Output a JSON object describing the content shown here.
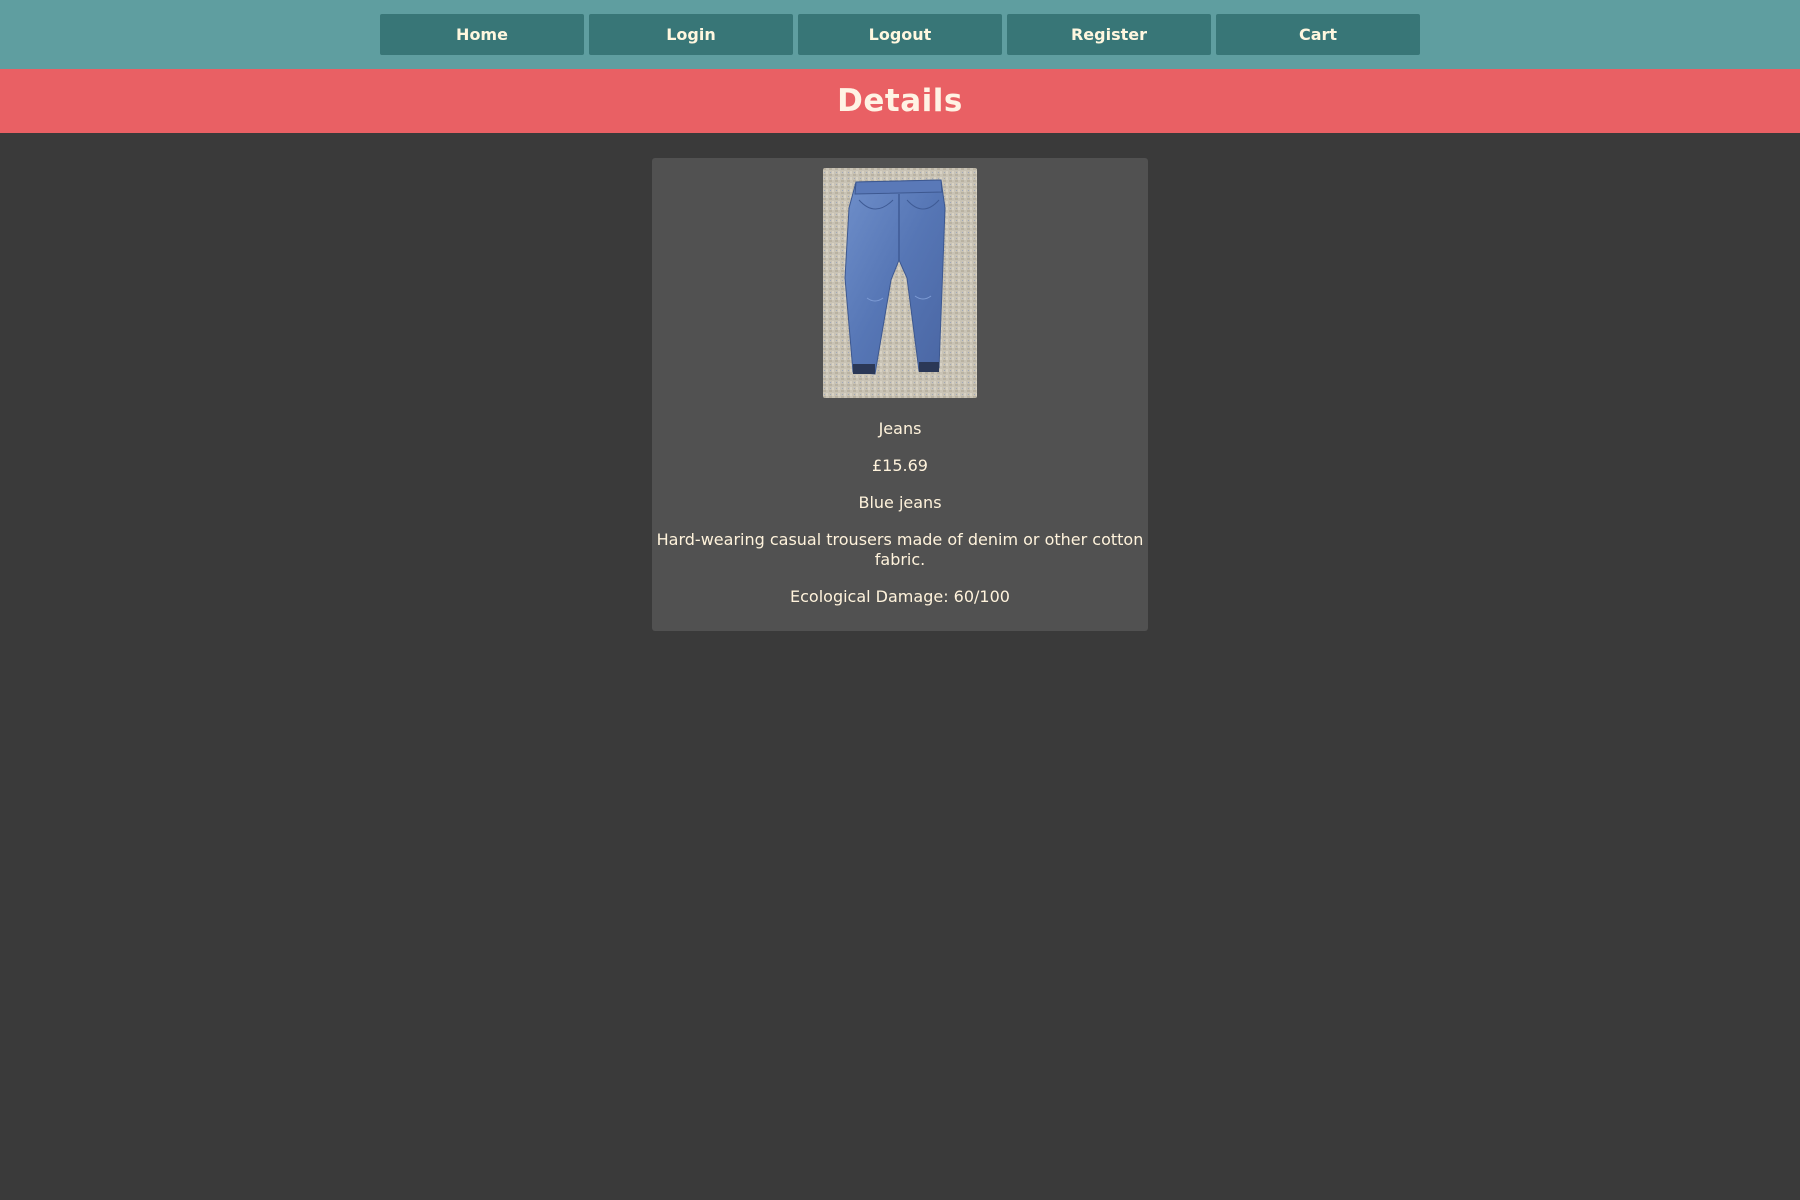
{
  "nav": {
    "items": [
      {
        "label": "Home"
      },
      {
        "label": "Login"
      },
      {
        "label": "Logout"
      },
      {
        "label": "Register"
      },
      {
        "label": "Cart"
      }
    ]
  },
  "header": {
    "title": "Details"
  },
  "product": {
    "image_icon": "jeans-photo",
    "name": "Jeans",
    "price": "£15.69",
    "short_description": "Blue jeans",
    "long_description": "Hard-wearing casual trousers made of denim or other cotton fabric.",
    "ecological_damage": "Ecological Damage: 60/100"
  },
  "colors": {
    "nav_background": "#5f9ea0",
    "nav_button": "#387677",
    "header_background": "#e96064",
    "page_background": "#3a3a3a",
    "card_background": "#515151",
    "text": "#fff3dc"
  }
}
